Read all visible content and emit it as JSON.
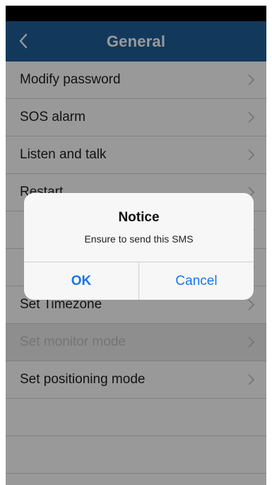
{
  "header": {
    "title": "General",
    "back_icon": "chevron-left-icon"
  },
  "menu": {
    "items": [
      {
        "label": "Modify password",
        "disabled": false
      },
      {
        "label": "SOS alarm",
        "disabled": false
      },
      {
        "label": "Listen and talk",
        "disabled": false
      },
      {
        "label": "Restart",
        "disabled": false
      },
      {
        "label": "",
        "disabled": false
      },
      {
        "label": "",
        "disabled": false
      },
      {
        "label": "Set Timezone",
        "disabled": false
      },
      {
        "label": "Set monitor mode",
        "disabled": true
      },
      {
        "label": "Set positioning mode",
        "disabled": false
      },
      {
        "label": "",
        "disabled": false
      },
      {
        "label": "",
        "disabled": false
      }
    ],
    "chevron_icon": "chevron-right-icon"
  },
  "dialog": {
    "title": "Notice",
    "message": "Ensure to send this SMS",
    "ok_label": "OK",
    "cancel_label": "Cancel"
  },
  "colors": {
    "nav_bar": "#1e5f99",
    "accent": "#1a74e8",
    "disabled_row": "#ededed"
  }
}
